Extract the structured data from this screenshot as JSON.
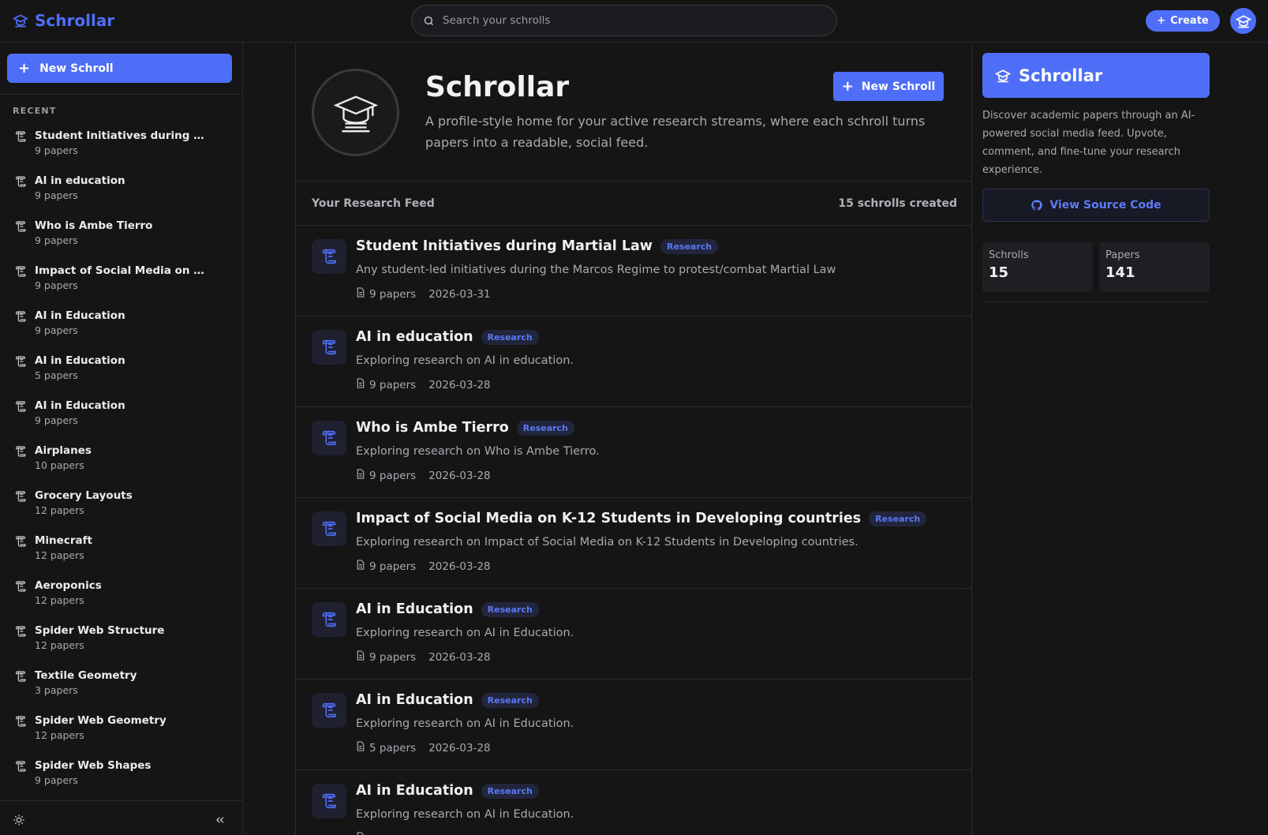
{
  "topbar": {
    "brand": "Schrollar",
    "search_placeholder": "Search your schrolls",
    "create_label": "Create"
  },
  "sidebar": {
    "new_button": "New Schroll",
    "recent_label": "RECENT",
    "items": [
      {
        "title": "Student Initiatives during Marti...",
        "count": "9 papers"
      },
      {
        "title": "AI in education",
        "count": "9 papers"
      },
      {
        "title": "Who is Ambe Tierro",
        "count": "9 papers"
      },
      {
        "title": "Impact of Social Media on K-12 ...",
        "count": "9 papers"
      },
      {
        "title": "AI in Education",
        "count": "9 papers"
      },
      {
        "title": "AI in Education",
        "count": "5 papers"
      },
      {
        "title": "AI in Education",
        "count": "9 papers"
      },
      {
        "title": "Airplanes",
        "count": "10 papers"
      },
      {
        "title": "Grocery Layouts",
        "count": "12 papers"
      },
      {
        "title": "Minecraft",
        "count": "12 papers"
      },
      {
        "title": "Aeroponics",
        "count": "12 papers"
      },
      {
        "title": "Spider Web Structure",
        "count": "12 papers"
      },
      {
        "title": "Textile Geometry",
        "count": "3 papers"
      },
      {
        "title": "Spider Web Geometry",
        "count": "12 papers"
      },
      {
        "title": "Spider Web Shapes",
        "count": "9 papers"
      }
    ]
  },
  "profile": {
    "title": "Schrollar",
    "description": "A profile-style home for your active research streams, where each schroll turns papers into a readable, social feed.",
    "new_button": "New Schroll"
  },
  "feed": {
    "header_label": "Your Research Feed",
    "header_count": "15 schrolls created",
    "items": [
      {
        "title": "Student Initiatives during Martial Law",
        "badge": "Research",
        "desc": "Any student-led initiatives during the Marcos Regime to protest/combat Martial Law",
        "papers": "9 papers",
        "date": "2026-03-31"
      },
      {
        "title": "AI in education",
        "badge": "Research",
        "desc": "Exploring research on AI in education.",
        "papers": "9 papers",
        "date": "2026-03-28"
      },
      {
        "title": "Who is Ambe Tierro",
        "badge": "Research",
        "desc": "Exploring research on Who is Ambe Tierro.",
        "papers": "9 papers",
        "date": "2026-03-28"
      },
      {
        "title": "Impact of Social Media on K-12 Students in Developing countries",
        "badge": "Research",
        "desc": "Exploring research on Impact of Social Media on K-12 Students in Developing countries.",
        "papers": "9 papers",
        "date": "2026-03-28"
      },
      {
        "title": "AI in Education",
        "badge": "Research",
        "desc": "Exploring research on AI in Education.",
        "papers": "9 papers",
        "date": "2026-03-28"
      },
      {
        "title": "AI in Education",
        "badge": "Research",
        "desc": "Exploring research on AI in Education.",
        "papers": "5 papers",
        "date": "2026-03-28"
      },
      {
        "title": "AI in Education",
        "badge": "Research",
        "desc": "Exploring research on AI in Education.",
        "papers": "",
        "date": ""
      }
    ]
  },
  "right": {
    "card_title": "Schrollar",
    "description": "Discover academic papers through an AI-powered social media feed. Upvote, comment, and fine-tune your research experience.",
    "source_button": "View Source Code",
    "stats": [
      {
        "label": "Schrolls",
        "value": "15"
      },
      {
        "label": "Papers",
        "value": "141"
      }
    ]
  },
  "colors": {
    "accent": "#4f6ef7",
    "background": "#151515",
    "badge_bg": "#21263d"
  },
  "icons": [
    "graduation-cap-icon",
    "search-icon",
    "plus-icon",
    "scroll-icon",
    "document-icon",
    "sun-icon",
    "chevrons-left-icon",
    "github-icon"
  ]
}
